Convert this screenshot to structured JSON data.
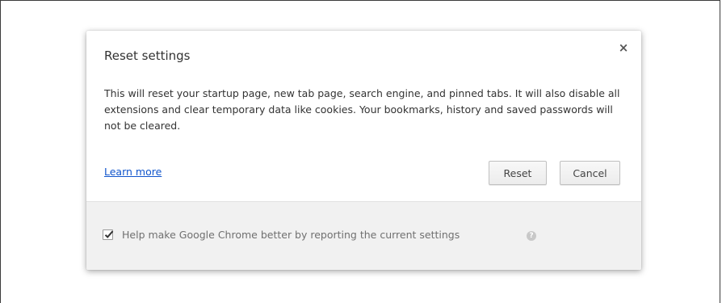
{
  "dialog": {
    "title": "Reset settings",
    "close_glyph": "×",
    "body": "This will reset your startup page, new tab page, search engine, and pinned tabs. It will also disable all extensions and clear temporary data like cookies. Your bookmarks, history and saved passwords will not be cleared.",
    "learn_more": "Learn more",
    "reset_label": "Reset",
    "cancel_label": "Cancel"
  },
  "footer": {
    "checkbox_checked": true,
    "label": "Help make Google Chrome better by reporting the current settings",
    "help_glyph": "?"
  },
  "colors": {
    "link": "#1155cc",
    "footer_bg": "#f1f1f1",
    "text": "#333333"
  },
  "icons": {
    "close": "close-icon",
    "check": "check-icon",
    "help": "help-icon"
  }
}
